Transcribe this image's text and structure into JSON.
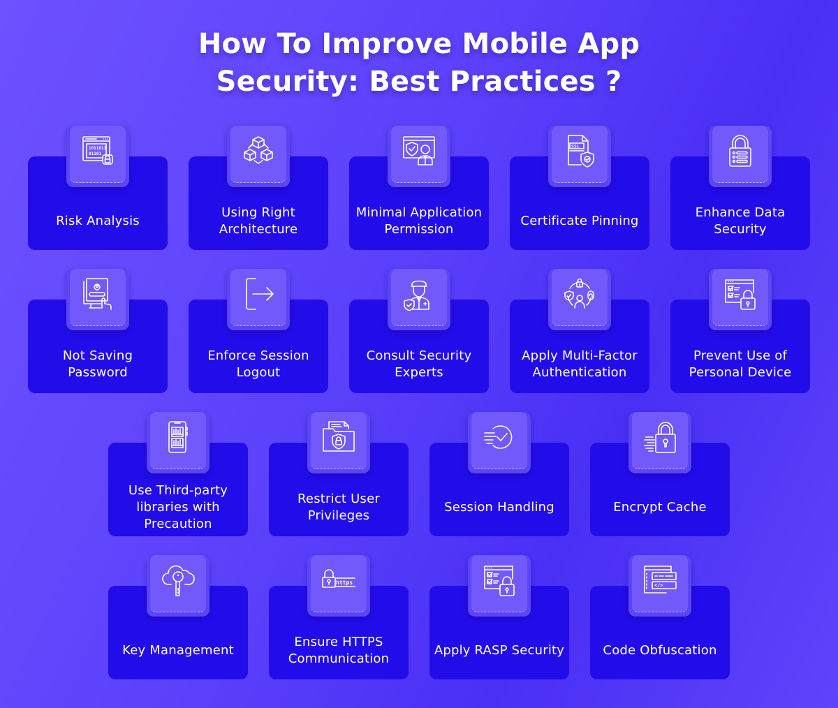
{
  "title": {
    "line1": "How To Improve Mobile App",
    "line2": "Security: Best Practices ?"
  },
  "colors": {
    "background": "#5a40fb",
    "card": "#230cea",
    "icon_box": "#7159fc",
    "text": "#ffffff"
  },
  "practices": [
    {
      "label": "Risk Analysis",
      "icon": "binary-lock-window-icon"
    },
    {
      "label": "Using Right Architecture",
      "icon": "cubes-network-icon"
    },
    {
      "label": "Minimal Application Permission",
      "icon": "user-shield-screen-icon"
    },
    {
      "label": "Certificate Pinning",
      "icon": "ssl-certificate-shield-icon"
    },
    {
      "label": "Enhance Data Security",
      "icon": "padlock-list-icon"
    },
    {
      "label": "Not Saving Password",
      "icon": "password-login-monitor-icon"
    },
    {
      "label": "Enforce Session Logout",
      "icon": "logout-icon"
    },
    {
      "label": "Consult Security Experts",
      "icon": "security-officer-icon"
    },
    {
      "label": "Apply Multi-Factor Authentication",
      "icon": "multi-factor-auth-icon"
    },
    {
      "label": "Prevent Use of Personal Device",
      "icon": "checklist-padlock-icon"
    },
    {
      "label": "Use Third-party libraries with Precaution",
      "icon": "phone-library-icon"
    },
    {
      "label": "Restrict User Privileges",
      "icon": "folder-shield-lock-icon"
    },
    {
      "label": "Session Handling",
      "icon": "fast-check-icon"
    },
    {
      "label": "Encrypt Cache",
      "icon": "fast-padlock-icon"
    },
    {
      "label": "Key Management",
      "icon": "cloud-key-icon"
    },
    {
      "label": "Ensure HTTPS Communication",
      "icon": "https-lock-icon"
    },
    {
      "label": "Apply RASP Security",
      "icon": "checklist-padlock-icon"
    },
    {
      "label": "Code Obfuscation",
      "icon": "code-window-icon"
    }
  ],
  "icon_text": {
    "binary1": "1011011",
    "binary2": "01101",
    "ssl": "SSL",
    "https": "https",
    "code": "</>"
  }
}
